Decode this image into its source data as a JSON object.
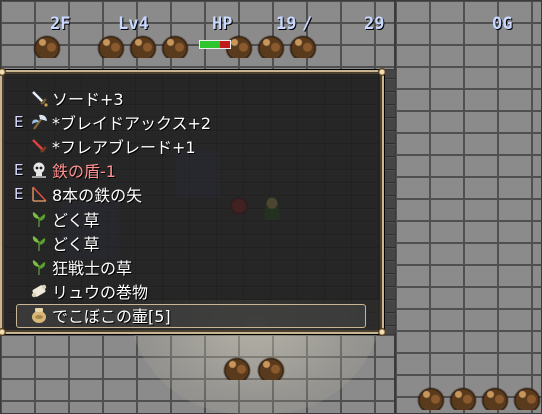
{
  "hud": {
    "floor": "2F",
    "level": "Lv4",
    "hp_label": "HP",
    "hp_current": "19",
    "hp_sep": "/",
    "hp_max": "29",
    "gold": "0G",
    "hp_fraction": 0.655
  },
  "menu": {
    "items": [
      {
        "equip": "",
        "icon": "sword-icon",
        "label": "ソード+3",
        "cursed": false
      },
      {
        "equip": "E",
        "icon": "axe-icon",
        "label": "*ブレイドアックス+2",
        "cursed": false
      },
      {
        "equip": "",
        "icon": "red-sword-icon",
        "label": "*フレアブレード+1",
        "cursed": false
      },
      {
        "equip": "E",
        "icon": "skull-shield-icon",
        "label": "鉄の盾-1",
        "cursed": true
      },
      {
        "equip": "E",
        "icon": "bow-arrow-icon",
        "label": "8本の鉄の矢",
        "cursed": false
      },
      {
        "equip": "",
        "icon": "herb-icon",
        "label": "どく草",
        "cursed": false
      },
      {
        "equip": "",
        "icon": "herb-icon",
        "label": "どく草",
        "cursed": false
      },
      {
        "equip": "",
        "icon": "herb-icon",
        "label": "狂戦士の草",
        "cursed": false
      },
      {
        "equip": "",
        "icon": "scroll-icon",
        "label": "リュウの巻物",
        "cursed": false
      },
      {
        "equip": "",
        "icon": "pot-icon",
        "label": "でこぼこの壷[5]",
        "cursed": false
      }
    ],
    "selected_index": 9
  },
  "colors": {
    "menu_border": "#c9b592",
    "cursed_text": "#ff9090",
    "hud_text": "#c8d8ff",
    "hp_green": "#2ec52e",
    "hp_red": "#c01a1a"
  }
}
